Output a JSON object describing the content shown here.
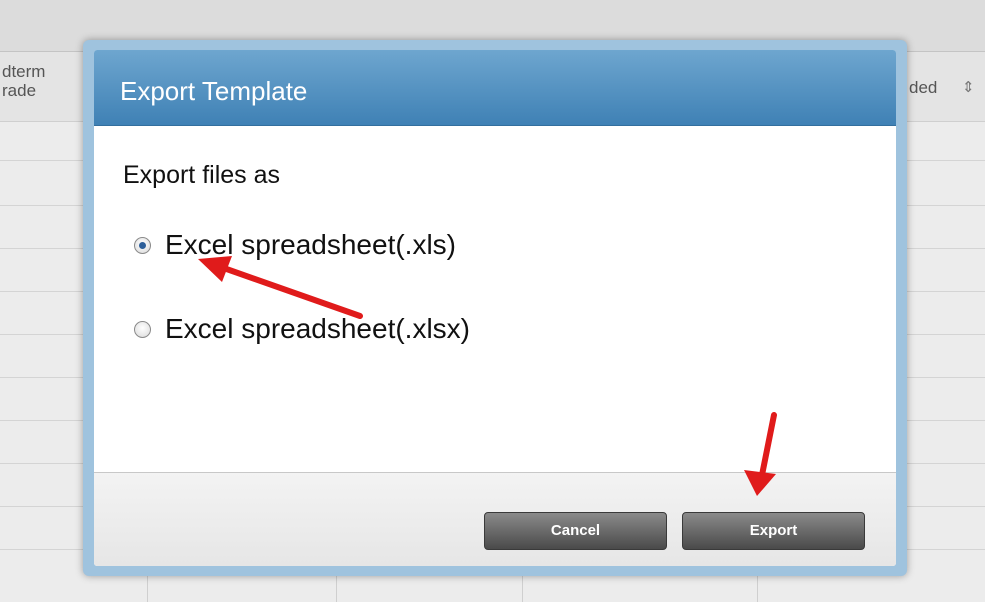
{
  "background": {
    "column_header_left": "dterm\nrade",
    "column_header_right": "ded",
    "sort_glyph": "⇕"
  },
  "modal": {
    "title": "Export Template",
    "section_label": "Export files as",
    "options": [
      {
        "label": "Excel spreadsheet(.xls)",
        "selected": true
      },
      {
        "label": "Excel spreadsheet(.xlsx)",
        "selected": false
      }
    ],
    "buttons": {
      "cancel": "Cancel",
      "export": "Export"
    }
  },
  "annotation": {
    "arrow_color": "#e01b1b"
  }
}
